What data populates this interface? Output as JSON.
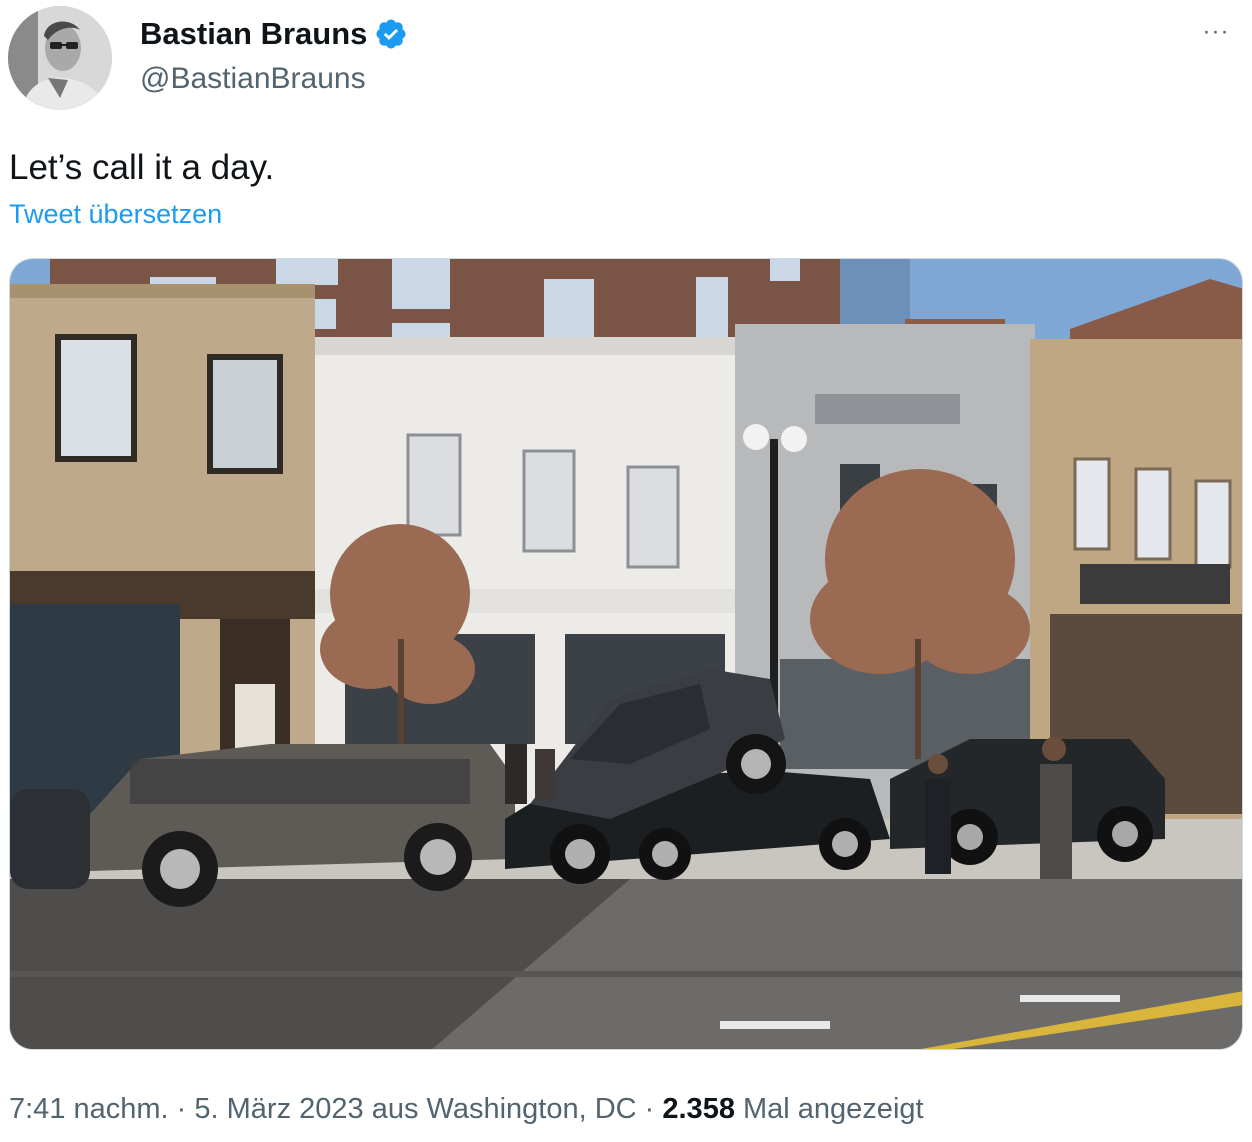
{
  "author": {
    "name": "Bastian Brauns",
    "handle": "@BastianBrauns",
    "verified": true,
    "verified_icon": "verified-badge-icon",
    "verified_color": "#1d9bf0"
  },
  "tweet": {
    "text": "Let’s call it a day.",
    "translate_label": "Tweet übersetzen",
    "more_label": "···",
    "media_icon": "photo-street-crash"
  },
  "meta": {
    "time": "7:41 nachm.",
    "sep1": " · ",
    "date": "5. März 2023",
    "location_label": " aus Washington, DC",
    "sep2": " · ",
    "views_count": "2.358",
    "views_label": " Mal angezeigt"
  },
  "colors": {
    "text": "#0f1419",
    "muted": "#536471",
    "link": "#1d9bf0",
    "border": "#cfd9de"
  }
}
